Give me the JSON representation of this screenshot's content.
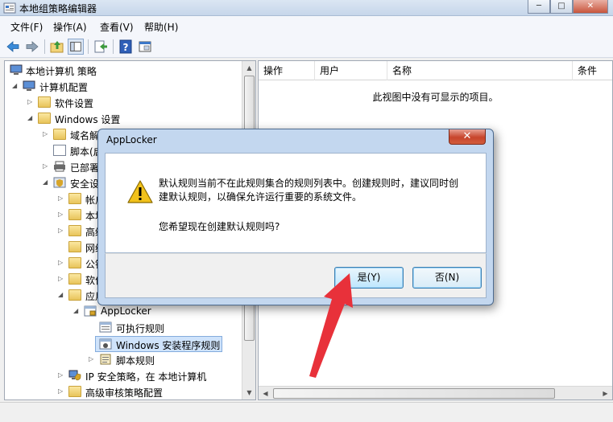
{
  "window": {
    "title": "本地组策略编辑器",
    "caption_min": "─",
    "caption_max": "□",
    "caption_close": "✕"
  },
  "menu": [
    "文件(F)",
    "操作(A)",
    "查看(V)",
    "帮助(H)"
  ],
  "tree": {
    "items": [
      {
        "label": "本地计算机 策略",
        "icon": "computer-icon"
      },
      {
        "label": "计算机配置",
        "icon": "computer-icon"
      },
      {
        "label": "软件设置",
        "icon": "folder-icon"
      },
      {
        "label": "Windows 设置",
        "icon": "folder-icon"
      },
      {
        "label": "域名解",
        "icon": "folder-icon"
      },
      {
        "label": "脚本(启",
        "icon": "script-icon"
      },
      {
        "label": "已部署",
        "icon": "printer-icon"
      },
      {
        "label": "安全设",
        "icon": "security-icon"
      },
      {
        "label": "帐户",
        "icon": "folder-icon"
      },
      {
        "label": "本地",
        "icon": "folder-icon"
      },
      {
        "label": "高级",
        "icon": "folder-icon"
      },
      {
        "label": "网络",
        "icon": "folder-icon"
      },
      {
        "label": "公钥",
        "icon": "folder-icon"
      },
      {
        "label": "软件",
        "icon": "folder-icon"
      },
      {
        "label": "应用",
        "icon": "folder-icon"
      },
      {
        "label": "AppLocker",
        "icon": "applocker-icon"
      },
      {
        "label": "可执行规则",
        "icon": "rule-icon"
      },
      {
        "label": "Windows 安装程序规则",
        "icon": "rule-icon"
      },
      {
        "label": "脚本规则",
        "icon": "rule-icon"
      },
      {
        "label": "IP 安全策略，在 本地计算机",
        "icon": "ipsec-icon"
      },
      {
        "label": "高级审核策略配置",
        "icon": "folder-icon"
      }
    ]
  },
  "list": {
    "columns": [
      "操作",
      "用户",
      "名称",
      "条件"
    ],
    "empty_message": "此视图中没有可显示的项目。"
  },
  "dialog": {
    "title": "AppLocker",
    "close": "✕",
    "message": "默认规则当前不在此规则集合的规则列表中。创建规则时，建议同时创建默认规则，以确保允许运行重要的系统文件。",
    "question": "您希望现在创建默认规则吗?",
    "yes_label": "是(Y)",
    "no_label": "否(N)"
  },
  "colors": {
    "annotation_arrow": "#e8313a",
    "dialog_frame": "#c3d7ef"
  }
}
